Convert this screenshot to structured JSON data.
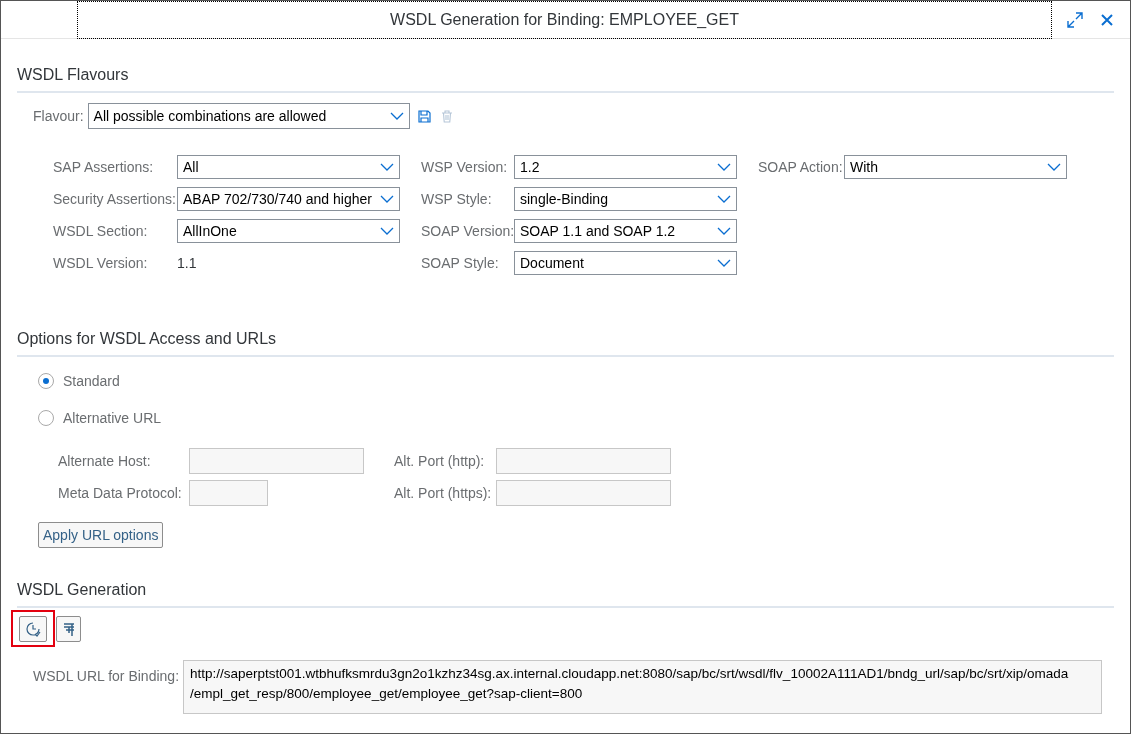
{
  "window": {
    "title": "WSDL Generation for Binding: EMPLOYEE_GET"
  },
  "flavours": {
    "heading": "WSDL Flavours",
    "flavour_label": "Flavour:",
    "flavour_value": "All possible combinations are allowed",
    "columns": [
      [
        {
          "label": "SAP Assertions:",
          "kind": "select",
          "value": "All"
        },
        {
          "label": "Security Assertions:",
          "kind": "select",
          "value": "ABAP 702/730/740 and higher"
        },
        {
          "label": "WSDL Section:",
          "kind": "select",
          "value": "AllInOne"
        },
        {
          "label": "WSDL Version:",
          "kind": "text",
          "value": "1.1"
        }
      ],
      [
        {
          "label": "WSP Version:",
          "kind": "select",
          "value": "1.2"
        },
        {
          "label": "WSP Style:",
          "kind": "select",
          "value": "single-Binding"
        },
        {
          "label": "SOAP Version:",
          "kind": "select",
          "value": "SOAP 1.1 and SOAP 1.2"
        },
        {
          "label": "SOAP Style:",
          "kind": "select",
          "value": "Document"
        }
      ],
      [
        {
          "label": "SOAP Action:",
          "kind": "select",
          "value": "With"
        }
      ]
    ]
  },
  "access": {
    "heading": "Options for WSDL Access and URLs",
    "radios": [
      {
        "label": "Standard",
        "selected": true
      },
      {
        "label": "Alternative URL",
        "selected": false
      }
    ],
    "fields": [
      {
        "label": "Alternate Host:"
      },
      {
        "label": "Alt. Port (http):"
      },
      {
        "label": "Meta Data Protocol:"
      },
      {
        "label": "Alt. Port (https):"
      }
    ],
    "apply_button": "Apply URL options"
  },
  "generation": {
    "heading": "WSDL Generation",
    "url_label": "WSDL URL for Binding:",
    "url_lines": [
      "http://saperptst001.wtbhufksmrdu3gn2o1kzhz34sg.ax.internal.cloudapp.net:8080/sap/bc/srt/wsdl/flv_10002A111AD1/bndg_url/sap/bc/srt/xip/omada",
      "/empl_get_resp/800/employee_get/employee_get?sap-client=800"
    ]
  }
}
